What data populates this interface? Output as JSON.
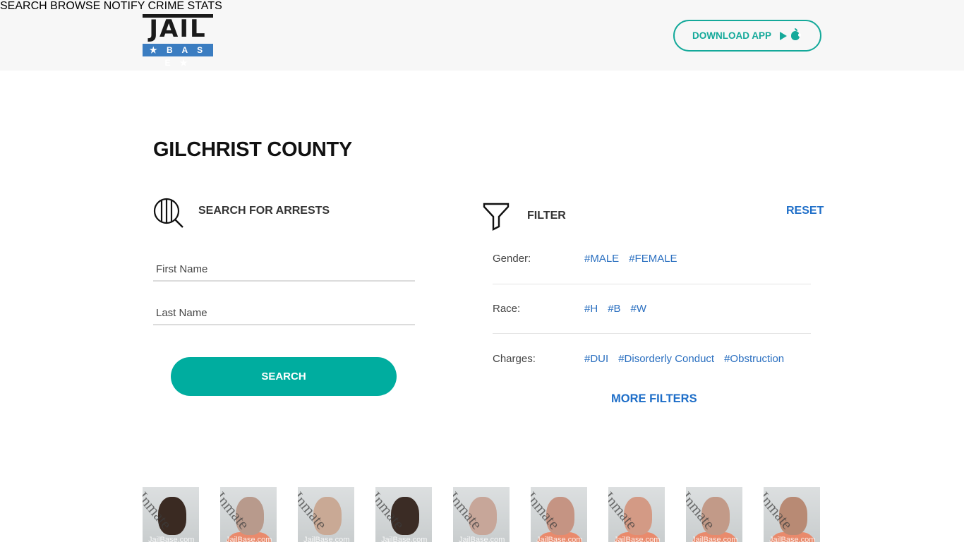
{
  "header": {
    "logo": {
      "top": "JAIL",
      "bottom": "★ B A S E ★"
    },
    "nav": [
      {
        "label": "SEARCH"
      },
      {
        "label": "BROWSE"
      },
      {
        "label": "NOTIFY"
      },
      {
        "label": "CRIME STATS"
      }
    ],
    "download_app": {
      "label": "DOWNLOAD APP",
      "icons": [
        "google-play-icon",
        "apple-icon"
      ]
    }
  },
  "page": {
    "title": "GILCHRIST COUNTY"
  },
  "search": {
    "title": "SEARCH FOR ARRESTS",
    "first_name": {
      "placeholder": "First Name",
      "value": ""
    },
    "last_name": {
      "placeholder": "Last Name",
      "value": ""
    },
    "button_label": "SEARCH"
  },
  "filter": {
    "title": "FILTER",
    "reset_label": "RESET",
    "rows": [
      {
        "label": "Gender:",
        "tags": [
          "#MALE",
          "#FEMALE"
        ]
      },
      {
        "label": "Race:",
        "tags": [
          "#H",
          "#B",
          "#W"
        ]
      },
      {
        "label": "Charges:",
        "tags": [
          "#DUI",
          "#Disorderly Conduct",
          "#Obstruction"
        ]
      }
    ],
    "more_label": "MORE FILTERS"
  },
  "mugshots": {
    "watermark": "Inmate",
    "site_watermark": "JailBase.com",
    "items": [
      {
        "skin": "#3a2a22",
        "shirt": false
      },
      {
        "skin": "#b89a8c",
        "shirt": true
      },
      {
        "skin": "#c9a995",
        "shirt": false
      },
      {
        "skin": "#3b2c25",
        "shirt": false
      },
      {
        "skin": "#c7a699",
        "shirt": false
      },
      {
        "skin": "#c59483",
        "shirt": true
      },
      {
        "skin": "#d39a85",
        "shirt": true
      },
      {
        "skin": "#c29a88",
        "shirt": true
      },
      {
        "skin": "#b88a74",
        "shirt": true
      }
    ]
  },
  "colors": {
    "accent_teal": "#00ad9f",
    "link_blue": "#1e6ec8",
    "logo_blue": "#3b7dc1"
  }
}
